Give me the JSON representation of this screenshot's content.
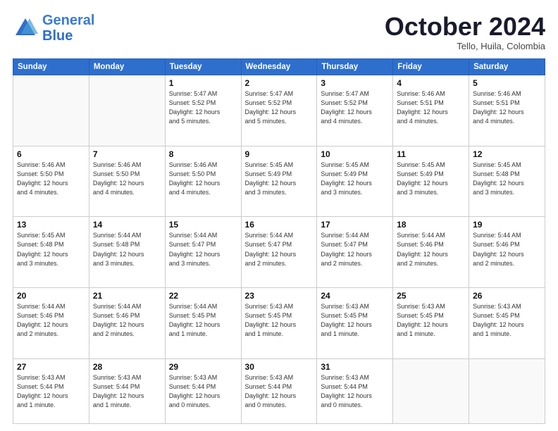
{
  "logo": {
    "line1": "General",
    "line2": "Blue"
  },
  "header": {
    "month": "October 2024",
    "location": "Tello, Huila, Colombia"
  },
  "weekdays": [
    "Sunday",
    "Monday",
    "Tuesday",
    "Wednesday",
    "Thursday",
    "Friday",
    "Saturday"
  ],
  "weeks": [
    [
      {
        "day": "",
        "info": ""
      },
      {
        "day": "",
        "info": ""
      },
      {
        "day": "1",
        "info": "Sunrise: 5:47 AM\nSunset: 5:52 PM\nDaylight: 12 hours\nand 5 minutes."
      },
      {
        "day": "2",
        "info": "Sunrise: 5:47 AM\nSunset: 5:52 PM\nDaylight: 12 hours\nand 5 minutes."
      },
      {
        "day": "3",
        "info": "Sunrise: 5:47 AM\nSunset: 5:52 PM\nDaylight: 12 hours\nand 4 minutes."
      },
      {
        "day": "4",
        "info": "Sunrise: 5:46 AM\nSunset: 5:51 PM\nDaylight: 12 hours\nand 4 minutes."
      },
      {
        "day": "5",
        "info": "Sunrise: 5:46 AM\nSunset: 5:51 PM\nDaylight: 12 hours\nand 4 minutes."
      }
    ],
    [
      {
        "day": "6",
        "info": "Sunrise: 5:46 AM\nSunset: 5:50 PM\nDaylight: 12 hours\nand 4 minutes."
      },
      {
        "day": "7",
        "info": "Sunrise: 5:46 AM\nSunset: 5:50 PM\nDaylight: 12 hours\nand 4 minutes."
      },
      {
        "day": "8",
        "info": "Sunrise: 5:46 AM\nSunset: 5:50 PM\nDaylight: 12 hours\nand 4 minutes."
      },
      {
        "day": "9",
        "info": "Sunrise: 5:45 AM\nSunset: 5:49 PM\nDaylight: 12 hours\nand 3 minutes."
      },
      {
        "day": "10",
        "info": "Sunrise: 5:45 AM\nSunset: 5:49 PM\nDaylight: 12 hours\nand 3 minutes."
      },
      {
        "day": "11",
        "info": "Sunrise: 5:45 AM\nSunset: 5:49 PM\nDaylight: 12 hours\nand 3 minutes."
      },
      {
        "day": "12",
        "info": "Sunrise: 5:45 AM\nSunset: 5:48 PM\nDaylight: 12 hours\nand 3 minutes."
      }
    ],
    [
      {
        "day": "13",
        "info": "Sunrise: 5:45 AM\nSunset: 5:48 PM\nDaylight: 12 hours\nand 3 minutes."
      },
      {
        "day": "14",
        "info": "Sunrise: 5:44 AM\nSunset: 5:48 PM\nDaylight: 12 hours\nand 3 minutes."
      },
      {
        "day": "15",
        "info": "Sunrise: 5:44 AM\nSunset: 5:47 PM\nDaylight: 12 hours\nand 3 minutes."
      },
      {
        "day": "16",
        "info": "Sunrise: 5:44 AM\nSunset: 5:47 PM\nDaylight: 12 hours\nand 2 minutes."
      },
      {
        "day": "17",
        "info": "Sunrise: 5:44 AM\nSunset: 5:47 PM\nDaylight: 12 hours\nand 2 minutes."
      },
      {
        "day": "18",
        "info": "Sunrise: 5:44 AM\nSunset: 5:46 PM\nDaylight: 12 hours\nand 2 minutes."
      },
      {
        "day": "19",
        "info": "Sunrise: 5:44 AM\nSunset: 5:46 PM\nDaylight: 12 hours\nand 2 minutes."
      }
    ],
    [
      {
        "day": "20",
        "info": "Sunrise: 5:44 AM\nSunset: 5:46 PM\nDaylight: 12 hours\nand 2 minutes."
      },
      {
        "day": "21",
        "info": "Sunrise: 5:44 AM\nSunset: 5:46 PM\nDaylight: 12 hours\nand 2 minutes."
      },
      {
        "day": "22",
        "info": "Sunrise: 5:44 AM\nSunset: 5:45 PM\nDaylight: 12 hours\nand 1 minute."
      },
      {
        "day": "23",
        "info": "Sunrise: 5:43 AM\nSunset: 5:45 PM\nDaylight: 12 hours\nand 1 minute."
      },
      {
        "day": "24",
        "info": "Sunrise: 5:43 AM\nSunset: 5:45 PM\nDaylight: 12 hours\nand 1 minute."
      },
      {
        "day": "25",
        "info": "Sunrise: 5:43 AM\nSunset: 5:45 PM\nDaylight: 12 hours\nand 1 minute."
      },
      {
        "day": "26",
        "info": "Sunrise: 5:43 AM\nSunset: 5:45 PM\nDaylight: 12 hours\nand 1 minute."
      }
    ],
    [
      {
        "day": "27",
        "info": "Sunrise: 5:43 AM\nSunset: 5:44 PM\nDaylight: 12 hours\nand 1 minute."
      },
      {
        "day": "28",
        "info": "Sunrise: 5:43 AM\nSunset: 5:44 PM\nDaylight: 12 hours\nand 1 minute."
      },
      {
        "day": "29",
        "info": "Sunrise: 5:43 AM\nSunset: 5:44 PM\nDaylight: 12 hours\nand 0 minutes."
      },
      {
        "day": "30",
        "info": "Sunrise: 5:43 AM\nSunset: 5:44 PM\nDaylight: 12 hours\nand 0 minutes."
      },
      {
        "day": "31",
        "info": "Sunrise: 5:43 AM\nSunset: 5:44 PM\nDaylight: 12 hours\nand 0 minutes."
      },
      {
        "day": "",
        "info": ""
      },
      {
        "day": "",
        "info": ""
      }
    ]
  ]
}
